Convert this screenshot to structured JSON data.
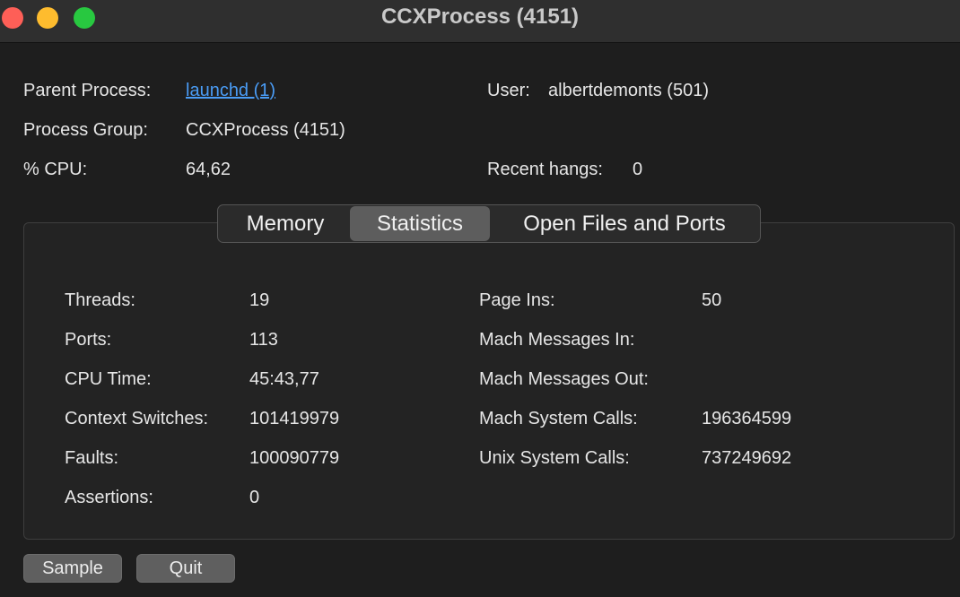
{
  "window": {
    "title": "CCXProcess (4151)"
  },
  "info": {
    "parent_process_label": "Parent Process:",
    "parent_process_value": "launchd (1)",
    "process_group_label": "Process Group:",
    "process_group_value": "CCXProcess (4151)",
    "cpu_label": "% CPU:",
    "cpu_value": "64,62",
    "user_label": "User:",
    "user_value": "albertdemonts (501)",
    "recent_hangs_label": "Recent hangs:",
    "recent_hangs_value": "0"
  },
  "tabs": [
    {
      "label": "Memory",
      "selected": false
    },
    {
      "label": "Statistics",
      "selected": true
    },
    {
      "label": "Open Files and Ports",
      "selected": false
    }
  ],
  "stats": {
    "left": [
      {
        "label": "Threads:",
        "value": "19"
      },
      {
        "label": "Ports:",
        "value": "113"
      },
      {
        "label": "CPU Time:",
        "value": "45:43,77"
      },
      {
        "label": "Context Switches:",
        "value": "101419979"
      },
      {
        "label": "Faults:",
        "value": "100090779"
      },
      {
        "label": "Assertions:",
        "value": "0"
      }
    ],
    "right": [
      {
        "label": "Page Ins:",
        "value": "50"
      },
      {
        "label": "Mach Messages In:",
        "value": ""
      },
      {
        "label": "Mach Messages Out:",
        "value": ""
      },
      {
        "label": "Mach System Calls:",
        "value": "196364599"
      },
      {
        "label": "Unix System Calls:",
        "value": "737249692"
      }
    ]
  },
  "buttons": {
    "sample": "Sample",
    "quit": "Quit"
  }
}
